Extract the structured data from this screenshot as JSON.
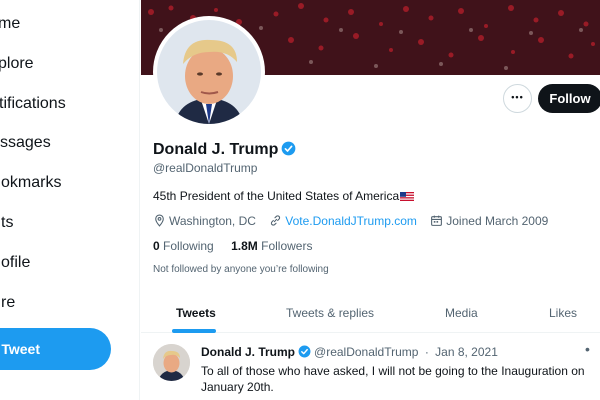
{
  "nav": {
    "items": [
      {
        "label": "me"
      },
      {
        "label": "plore"
      },
      {
        "label": "tifications"
      },
      {
        "label": "ssages"
      },
      {
        "label": "okmarks"
      },
      {
        "label": "ts"
      },
      {
        "label": "ofile"
      },
      {
        "label": "re"
      }
    ],
    "tweet_button": "Tweet"
  },
  "profile": {
    "name": "Donald J. Trump",
    "handle": "@realDonaldTrump",
    "bio": "45th President of the United States of America",
    "location": "Washington, DC",
    "website": "Vote.DonaldJTrump.com",
    "joined": "Joined March 2009",
    "following_count": "0",
    "following_label": "Following",
    "followers_count": "1.8M",
    "followers_label": "Followers",
    "not_followed": "Not followed by anyone you’re following",
    "more_label": "•••",
    "follow_label": "Follow"
  },
  "tabs": [
    "Tweets",
    "Tweets & replies",
    "Media",
    "Likes"
  ],
  "tweet": {
    "name": "Donald J. Trump",
    "handle": "@realDonaldTrump",
    "sep": "·",
    "date": "Jan 8, 2021",
    "more": "•",
    "text": "To all of those who have asked, I will not be going to the Inauguration on January 20th."
  },
  "colors": {
    "accent": "#1d9bf0",
    "text": "#0f1419",
    "muted": "#536471",
    "border": "#eff3f4"
  }
}
